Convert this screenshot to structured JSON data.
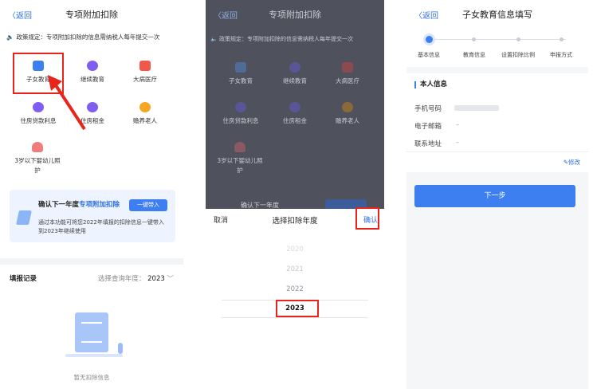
{
  "panel1": {
    "back": "〈返回",
    "title": "专项附加扣除",
    "notice": "政策规定：专项附加扣除的信息需纳税人每年提交一次",
    "categories": [
      {
        "label": "子女教育",
        "icon": "child-education-icon"
      },
      {
        "label": "继续教育",
        "icon": "graduation-cap-icon"
      },
      {
        "label": "大病医疗",
        "icon": "medical-kit-icon"
      },
      {
        "label": "住房贷款利息",
        "icon": "house-loan-icon"
      },
      {
        "label": "住房租金",
        "icon": "house-rent-icon"
      },
      {
        "label": "赡养老人",
        "icon": "elderly-icon"
      },
      {
        "label": "3岁以下婴幼儿照护",
        "icon": "infant-icon"
      }
    ],
    "import_card": {
      "title_pre": "确认下一年度",
      "title_hl": "专项附加扣除",
      "button": "一键带入",
      "desc": "通过本功能可将您2022年填报的扣除信息一键带入到2023年继续使用"
    },
    "records_title": "填报记录",
    "year_select_label": "选择查询年度：",
    "year_select_value": "2023",
    "empty_text": "暂无扣除信息",
    "colors": {
      "accent": "#3d7ef0",
      "highlight_box": "#e8241b"
    }
  },
  "panel2": {
    "back": "〈返回",
    "title": "专项附加扣除",
    "notice": "政策规定：专项附加扣除的信息需纳税人每年提交一次",
    "categories": [
      "子女教育",
      "继续教育",
      "大病医疗",
      "住房贷款利息",
      "住房租金",
      "赡养老人",
      "3岁以下婴幼儿照护"
    ],
    "behind_text": "确认下一年度",
    "sheet": {
      "cancel": "取消",
      "title": "选择扣除年度",
      "confirm": "确认",
      "years": [
        "2020",
        "2021",
        "2022",
        "2023"
      ],
      "selected": "2023"
    }
  },
  "panel3": {
    "back": "〈返回",
    "title": "子女教育信息填写",
    "steps": [
      "基本信息",
      "教育信息",
      "设置扣除比例",
      "申报方式"
    ],
    "section_title": "本人信息",
    "fields": [
      {
        "label": "手机号码",
        "value": ""
      },
      {
        "label": "电子邮箱",
        "value": "–"
      },
      {
        "label": "联系地址",
        "value": "–"
      }
    ],
    "edit": "修改",
    "next_button": "下一步"
  }
}
